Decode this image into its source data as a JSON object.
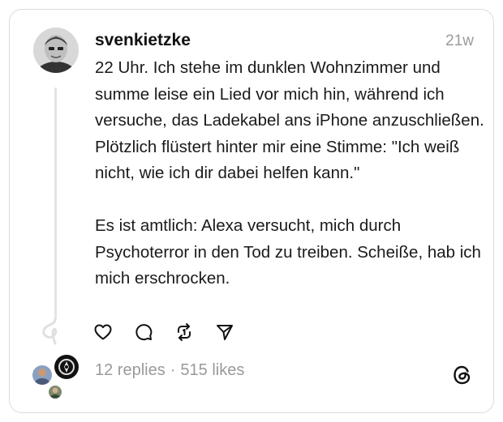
{
  "post": {
    "username": "svenkietzke",
    "time": "21w",
    "paragraphs": [
      "22 Uhr. Ich stehe im dunklen Wohnzimmer und summe leise ein Lied vor mich hin, während ich versuche, das Ladekabel ans iPhone anzuschließen. Plötzlich flüstert hinter mir eine Stimme: \"Ich weiß nicht, wie ich dir dabei helfen kann.\"",
      "Es ist amtlich: Alexa versucht, mich durch Psychoterror in den Tod zu treiben. Scheiße, hab ich mich erschrocken."
    ],
    "replies": "12 replies",
    "separator": "·",
    "likes": "515 likes"
  },
  "icons": {
    "like": "heart-icon",
    "reply": "comment-icon",
    "repost": "repost-icon",
    "share": "send-icon",
    "brand": "threads-logo-icon"
  },
  "colors": {
    "text": "#1a1a1a",
    "muted": "#9a9a9a",
    "border": "#dcdcdc"
  }
}
